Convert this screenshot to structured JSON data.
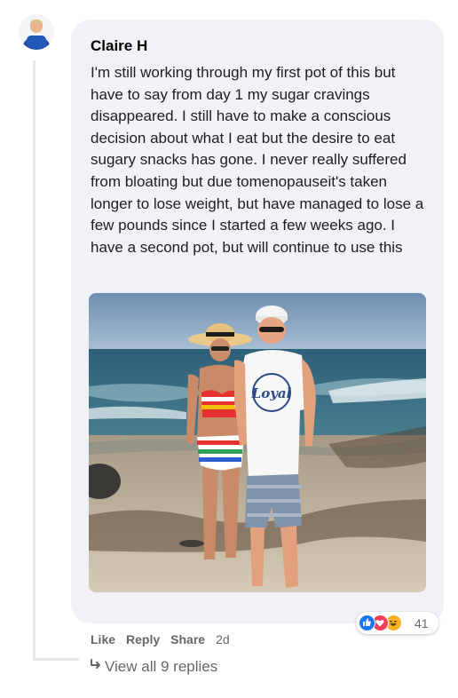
{
  "comment": {
    "author": "Claire H",
    "text": "I'm still working through my first pot of this but have to say from day 1 my sugar cravings disappeared. I still have to make a conscious decision about what I eat but the desire to eat sugary snacks has gone. I never really suffered from bloating but due tomenopauseit's taken longer to lose weight, but have managed to lose a few pounds since I started a few weeks ago. I have a second pot, but will continue to use this",
    "hat_logo": "Loyal"
  },
  "reactions": {
    "icons": [
      "like-icon",
      "love-icon",
      "haha-icon"
    ],
    "count": "41",
    "colors": {
      "like": "#1877f2",
      "love": "#f33e58",
      "haha": "#f7b125"
    }
  },
  "actions": {
    "like": "Like",
    "reply": "Reply",
    "share": "Share",
    "time": "2d"
  },
  "replies": {
    "label": "View all 9 replies"
  },
  "colors": {
    "bubble": "#f0f2f5",
    "text": "#1c1e21",
    "secondary": "#65676b"
  }
}
